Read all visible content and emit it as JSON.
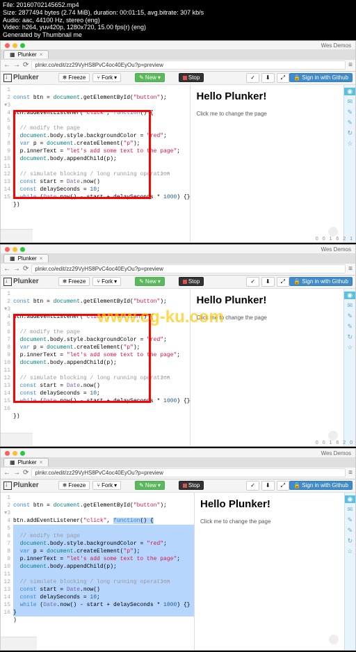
{
  "meta": {
    "file": "File: 20160702145652.mp4",
    "size": "Size: 2877494 bytes (2.74 MiB), duration: 00:01:15, avg.bitrate: 307 kb/s",
    "audio": "Audio: aac, 44100 Hz, stereo (eng)",
    "video": "Video: h264, yuv420p, 1280x720, 15.00 fps(r) (eng)",
    "gen": "Generated by Thumbnail me"
  },
  "watermark": "www.cg-ku.com",
  "browser": {
    "title_right": "Wes Demos",
    "tab": "Plunker",
    "url": "plnkr.co/edit/zz29VyHS8PvC4oc40EyOu?p=preview"
  },
  "toolbar": {
    "logo": "Plunker",
    "freeze": "Freeze",
    "fork": "Fork",
    "new": "New",
    "stop": "Stop",
    "signin": "Sign in with Github"
  },
  "preview": {
    "hello": "Hello Plunker!",
    "click": "Click me to change the page"
  },
  "code": {
    "l1a": "const",
    "l1b": " btn = ",
    "l1c": "document",
    "l1d": ".getElementById(",
    "l1e": "\"button\"",
    "l1f": ");",
    "l3a": "btn.addEventListener(",
    "l3b": "\"click\"",
    "l3c": ", ",
    "l3d": "function",
    "l3e": "() {",
    "l5": "  // modify the page",
    "l6a": "  document",
    "l6b": ".body.style.backgroundColor = ",
    "l6c": "\"red\"",
    "l6d": ";",
    "l7a": "  var",
    "l7b": " p = ",
    "l7c": "document",
    "l7d": ".createElement(",
    "l7e": "\"p\"",
    "l7f": ");",
    "l8a": "  p.innerText = ",
    "l8b": "\"let's add some text to the page\"",
    "l8c": ";",
    "l9a": "  document",
    "l9b": ".body.appendChild(p);",
    "l11": "  // simulate blocking / long running operation",
    "l12a": "  const",
    "l12b": " start = ",
    "l12c": "Date",
    "l12d": ".now()",
    "l13a": "  const",
    "l13b": " delaySeconds = ",
    "l13c": "10",
    "l13d": ";",
    "l14a": "  while",
    "l14b": " (",
    "l14c": "Date",
    "l14d": ".now() - start + delaySeconds * ",
    "l14e": "1000",
    "l14f": ") {}",
    "l15": "})"
  },
  "ln": {
    "1": "1",
    "2": "2",
    "3": "3",
    "4": "4",
    "5": "5",
    "6": "6",
    "7": "7",
    "8": "8",
    "9": "9",
    "10": "10",
    "11": "11",
    "12": "12",
    "13": "13",
    "14": "14",
    "15": "15",
    "16": "16"
  }
}
